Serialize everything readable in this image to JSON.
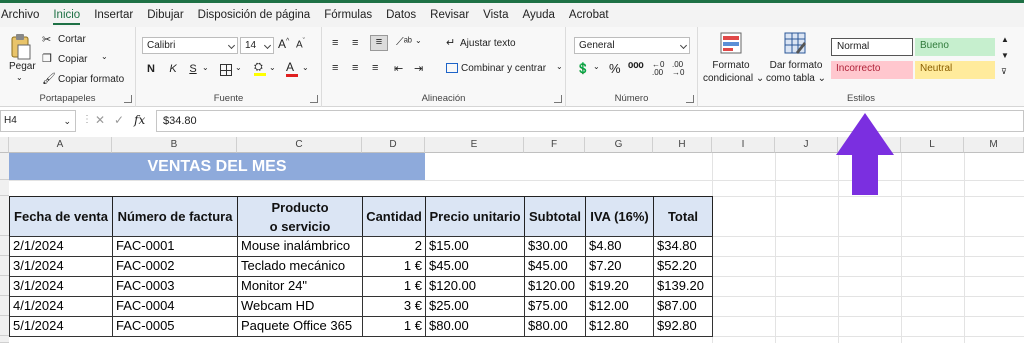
{
  "menu": {
    "tabs": [
      "Archivo",
      "Inicio",
      "Insertar",
      "Dibujar",
      "Disposición de página",
      "Fórmulas",
      "Datos",
      "Revisar",
      "Vista",
      "Ayuda",
      "Acrobat"
    ],
    "active_tab": "Inicio"
  },
  "ribbon": {
    "clipboard": {
      "paste": "Pegar",
      "cut": "Cortar",
      "copy": "Copiar",
      "format_painter": "Copiar formato",
      "label": "Portapapeles"
    },
    "font": {
      "name": "Calibri",
      "size": "14",
      "bold": "N",
      "italic": "K",
      "underline": "S",
      "label": "Fuente"
    },
    "alignment": {
      "wrap_text": "Ajustar texto",
      "merge": "Combinar y centrar",
      "label": "Alineación"
    },
    "number": {
      "format": "General",
      "label": "Número"
    },
    "styles": {
      "conditional_line1": "Formato",
      "conditional_line2": "condicional",
      "table_line1": "Dar formato",
      "table_line2": "como tabla",
      "normal": "Normal",
      "good": "Bueno",
      "bad": "Incorrecto",
      "neutral": "Neutral",
      "label": "Estilos"
    }
  },
  "formula_bar": {
    "name_box": "H4",
    "formula": "$34.80"
  },
  "colors": {
    "accent_green": "#1e7145",
    "title_fill": "#8eaadb",
    "header_fill": "#dbe5f4",
    "arrow": "#7b2fe0"
  },
  "columns": [
    "A",
    "B",
    "C",
    "D",
    "E",
    "F",
    "G",
    "H",
    "I",
    "J",
    "K",
    "L",
    "M"
  ],
  "sheet": {
    "title": "VENTAS DEL MES",
    "headers": [
      "Fecha de venta",
      "Número de factura",
      "Producto o servicio",
      "Cantidad",
      "Precio unitario",
      "Subtotal",
      "IVA (16%)",
      "Total"
    ],
    "rows": [
      [
        "2/1/2024",
        "FAC-0001",
        "Mouse inalámbrico",
        "2",
        "$15.00",
        "$30.00",
        "$4.80",
        "$34.80"
      ],
      [
        "3/1/2024",
        "FAC-0002",
        "Teclado mecánico",
        "1 €",
        "$45.00",
        "$45.00",
        "$7.20",
        "$52.20"
      ],
      [
        "3/1/2024",
        "FAC-0003",
        "Monitor 24\"",
        "1 €",
        "$120.00",
        "$120.00",
        "$19.20",
        "$139.20"
      ],
      [
        "4/1/2024",
        "FAC-0004",
        "Webcam HD",
        "3 €",
        "$25.00",
        "$75.00",
        "$12.00",
        "$87.00"
      ],
      [
        "5/1/2024",
        "FAC-0005",
        "Paquete Office 365",
        "1 €",
        "$80.00",
        "$80.00",
        "$12.80",
        "$92.80"
      ]
    ]
  }
}
